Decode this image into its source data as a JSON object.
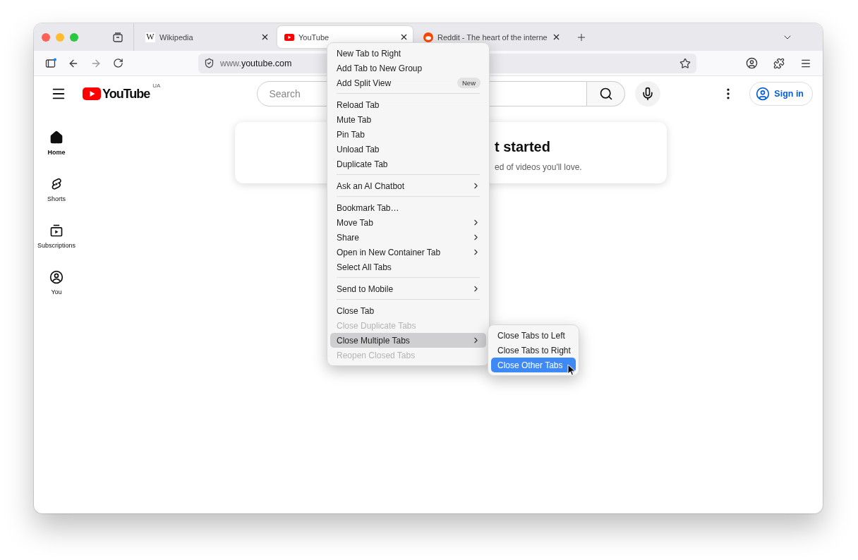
{
  "tabs": [
    {
      "kind": "wiki",
      "favicon_text": "W",
      "title": "Wikipedia",
      "selected": false
    },
    {
      "kind": "youtube",
      "title": "YouTube",
      "selected": true
    },
    {
      "kind": "reddit",
      "title": "Reddit - The heart of the interne",
      "selected": false
    }
  ],
  "address_bar": {
    "prefix": "www.",
    "host": "youtube.com"
  },
  "youtube": {
    "logo": "YouTube",
    "region": "UA",
    "search_placeholder": "Search",
    "sign_in": "Sign in",
    "sidebar": [
      {
        "kind": "home",
        "label": "Home",
        "selected": true
      },
      {
        "kind": "shorts",
        "label": "Shorts",
        "selected": false
      },
      {
        "kind": "subscriptions",
        "label": "Subscriptions",
        "selected": false
      },
      {
        "kind": "you",
        "label": "You",
        "selected": false
      }
    ],
    "prompt": {
      "heading": "t started",
      "text": "ed of videos you'll love."
    }
  },
  "context_menu": [
    {
      "kind": "item",
      "label": "New Tab to Right",
      "disabled": false,
      "submenu": false,
      "selected": false
    },
    {
      "kind": "item",
      "label": "Add Tab to New Group",
      "disabled": false,
      "submenu": false,
      "selected": false
    },
    {
      "kind": "item",
      "label": "Add Split View",
      "badge": "New",
      "disabled": false,
      "submenu": false,
      "selected": false
    },
    {
      "kind": "separator"
    },
    {
      "kind": "item",
      "label": "Reload Tab",
      "disabled": false,
      "submenu": false,
      "selected": false
    },
    {
      "kind": "item",
      "label": "Mute Tab",
      "disabled": false,
      "submenu": false,
      "selected": false
    },
    {
      "kind": "item",
      "label": "Pin Tab",
      "disabled": false,
      "submenu": false,
      "selected": false
    },
    {
      "kind": "item",
      "label": "Unload Tab",
      "disabled": false,
      "submenu": false,
      "selected": false
    },
    {
      "kind": "item",
      "label": "Duplicate Tab",
      "disabled": false,
      "submenu": false,
      "selected": false
    },
    {
      "kind": "separator"
    },
    {
      "kind": "item",
      "label": "Ask an AI Chatbot",
      "disabled": false,
      "submenu": true,
      "selected": false
    },
    {
      "kind": "separator"
    },
    {
      "kind": "item",
      "label": "Bookmark Tab…",
      "disabled": false,
      "submenu": false,
      "selected": false
    },
    {
      "kind": "item",
      "label": "Move Tab",
      "disabled": false,
      "submenu": true,
      "selected": false
    },
    {
      "kind": "item",
      "label": "Share",
      "disabled": false,
      "submenu": true,
      "selected": false
    },
    {
      "kind": "item",
      "label": "Open in New Container Tab",
      "disabled": false,
      "submenu": true,
      "selected": false
    },
    {
      "kind": "item",
      "label": "Select All Tabs",
      "disabled": false,
      "submenu": false,
      "selected": false
    },
    {
      "kind": "separator"
    },
    {
      "kind": "item",
      "label": "Send to Mobile",
      "disabled": false,
      "submenu": true,
      "selected": false
    },
    {
      "kind": "separator"
    },
    {
      "kind": "item",
      "label": "Close Tab",
      "disabled": false,
      "submenu": false,
      "selected": false
    },
    {
      "kind": "item",
      "label": "Close Duplicate Tabs",
      "disabled": true,
      "submenu": false,
      "selected": false
    },
    {
      "kind": "item",
      "label": "Close Multiple Tabs",
      "disabled": false,
      "submenu": true,
      "selected": true
    },
    {
      "kind": "item",
      "label": "Reopen Closed Tabs",
      "disabled": true,
      "submenu": false,
      "selected": false
    }
  ],
  "submenu": [
    {
      "label": "Close Tabs to Left",
      "selected": false
    },
    {
      "label": "Close Tabs to Right",
      "selected": false
    },
    {
      "label": "Close Other Tabs",
      "selected": true
    }
  ]
}
